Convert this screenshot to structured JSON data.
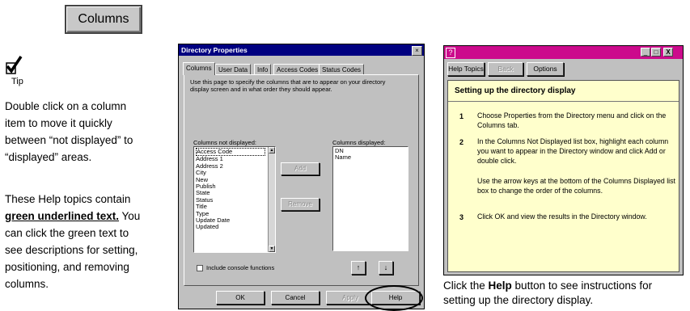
{
  "columns_button": {
    "label": "Columns"
  },
  "tip": {
    "label": "Tip",
    "p1": [
      "Double click on a column",
      "item to move it quickly",
      "between “not displayed” to",
      "“displayed” areas."
    ],
    "p2_line1": "These Help topics contain",
    "p2_green": "green underlined text.",
    "p2_after": " You",
    "p2_rest": [
      "can click the green text to",
      "see descriptions for setting,",
      "positioning, and removing",
      "columns."
    ]
  },
  "dialog": {
    "title": "Directory Properties",
    "close": "×",
    "tabs": [
      "Columns",
      "User Data",
      "Info",
      "Access Codes",
      "Status Codes"
    ],
    "instructions": [
      "Use this page to specify the columns that are to appear on your directory",
      "display screen and in what order they should appear."
    ],
    "not_displayed_label": "Columns not displayed:",
    "displayed_label": "Columns displayed:",
    "not_displayed": [
      "Access Code",
      "Address 1",
      "Address 2",
      "City",
      "New",
      "Publish",
      "State",
      "Status",
      "Title",
      "Type",
      "Update Date",
      "Updated"
    ],
    "displayed": [
      "DN",
      "Name"
    ],
    "add": "Add",
    "remove": "Remove",
    "include_console": "Include console functions",
    "up_arrow": "↑",
    "down_arrow": "↓",
    "ok": "OK",
    "cancel": "Cancel",
    "apply": "Apply",
    "help": "Help"
  },
  "help_window": {
    "title_icon": "?",
    "min": "_",
    "max": "□",
    "close": "X",
    "help_topics": "Help Topics",
    "back": "Back",
    "options": "Options",
    "heading": "Setting up the directory display",
    "steps": [
      {
        "num": "1",
        "lines": [
          "Choose Properties from the Directory menu and click on the",
          "Columns tab."
        ]
      },
      {
        "num": "2",
        "lines": [
          "In the Columns Not Displayed list box, highlight each column",
          "you want to appear in the Directory window and click Add or",
          "double click."
        ]
      },
      {
        "num": "",
        "lines": [
          "Use the arrow keys at the bottom of the Columns Displayed list",
          "box to change the order of the columns."
        ]
      },
      {
        "num": "3",
        "lines": [
          "Click OK and view the results in the Directory window."
        ]
      }
    ]
  },
  "caption": {
    "pre": "Click the ",
    "bold": "Help",
    "post": " button to see instructions for",
    "line2": "setting up the directory display."
  },
  "colors": {
    "dialog_title_bg": "#000080",
    "help_title_bg": "#cc0a8c",
    "help_bg": "#ffffcc"
  }
}
